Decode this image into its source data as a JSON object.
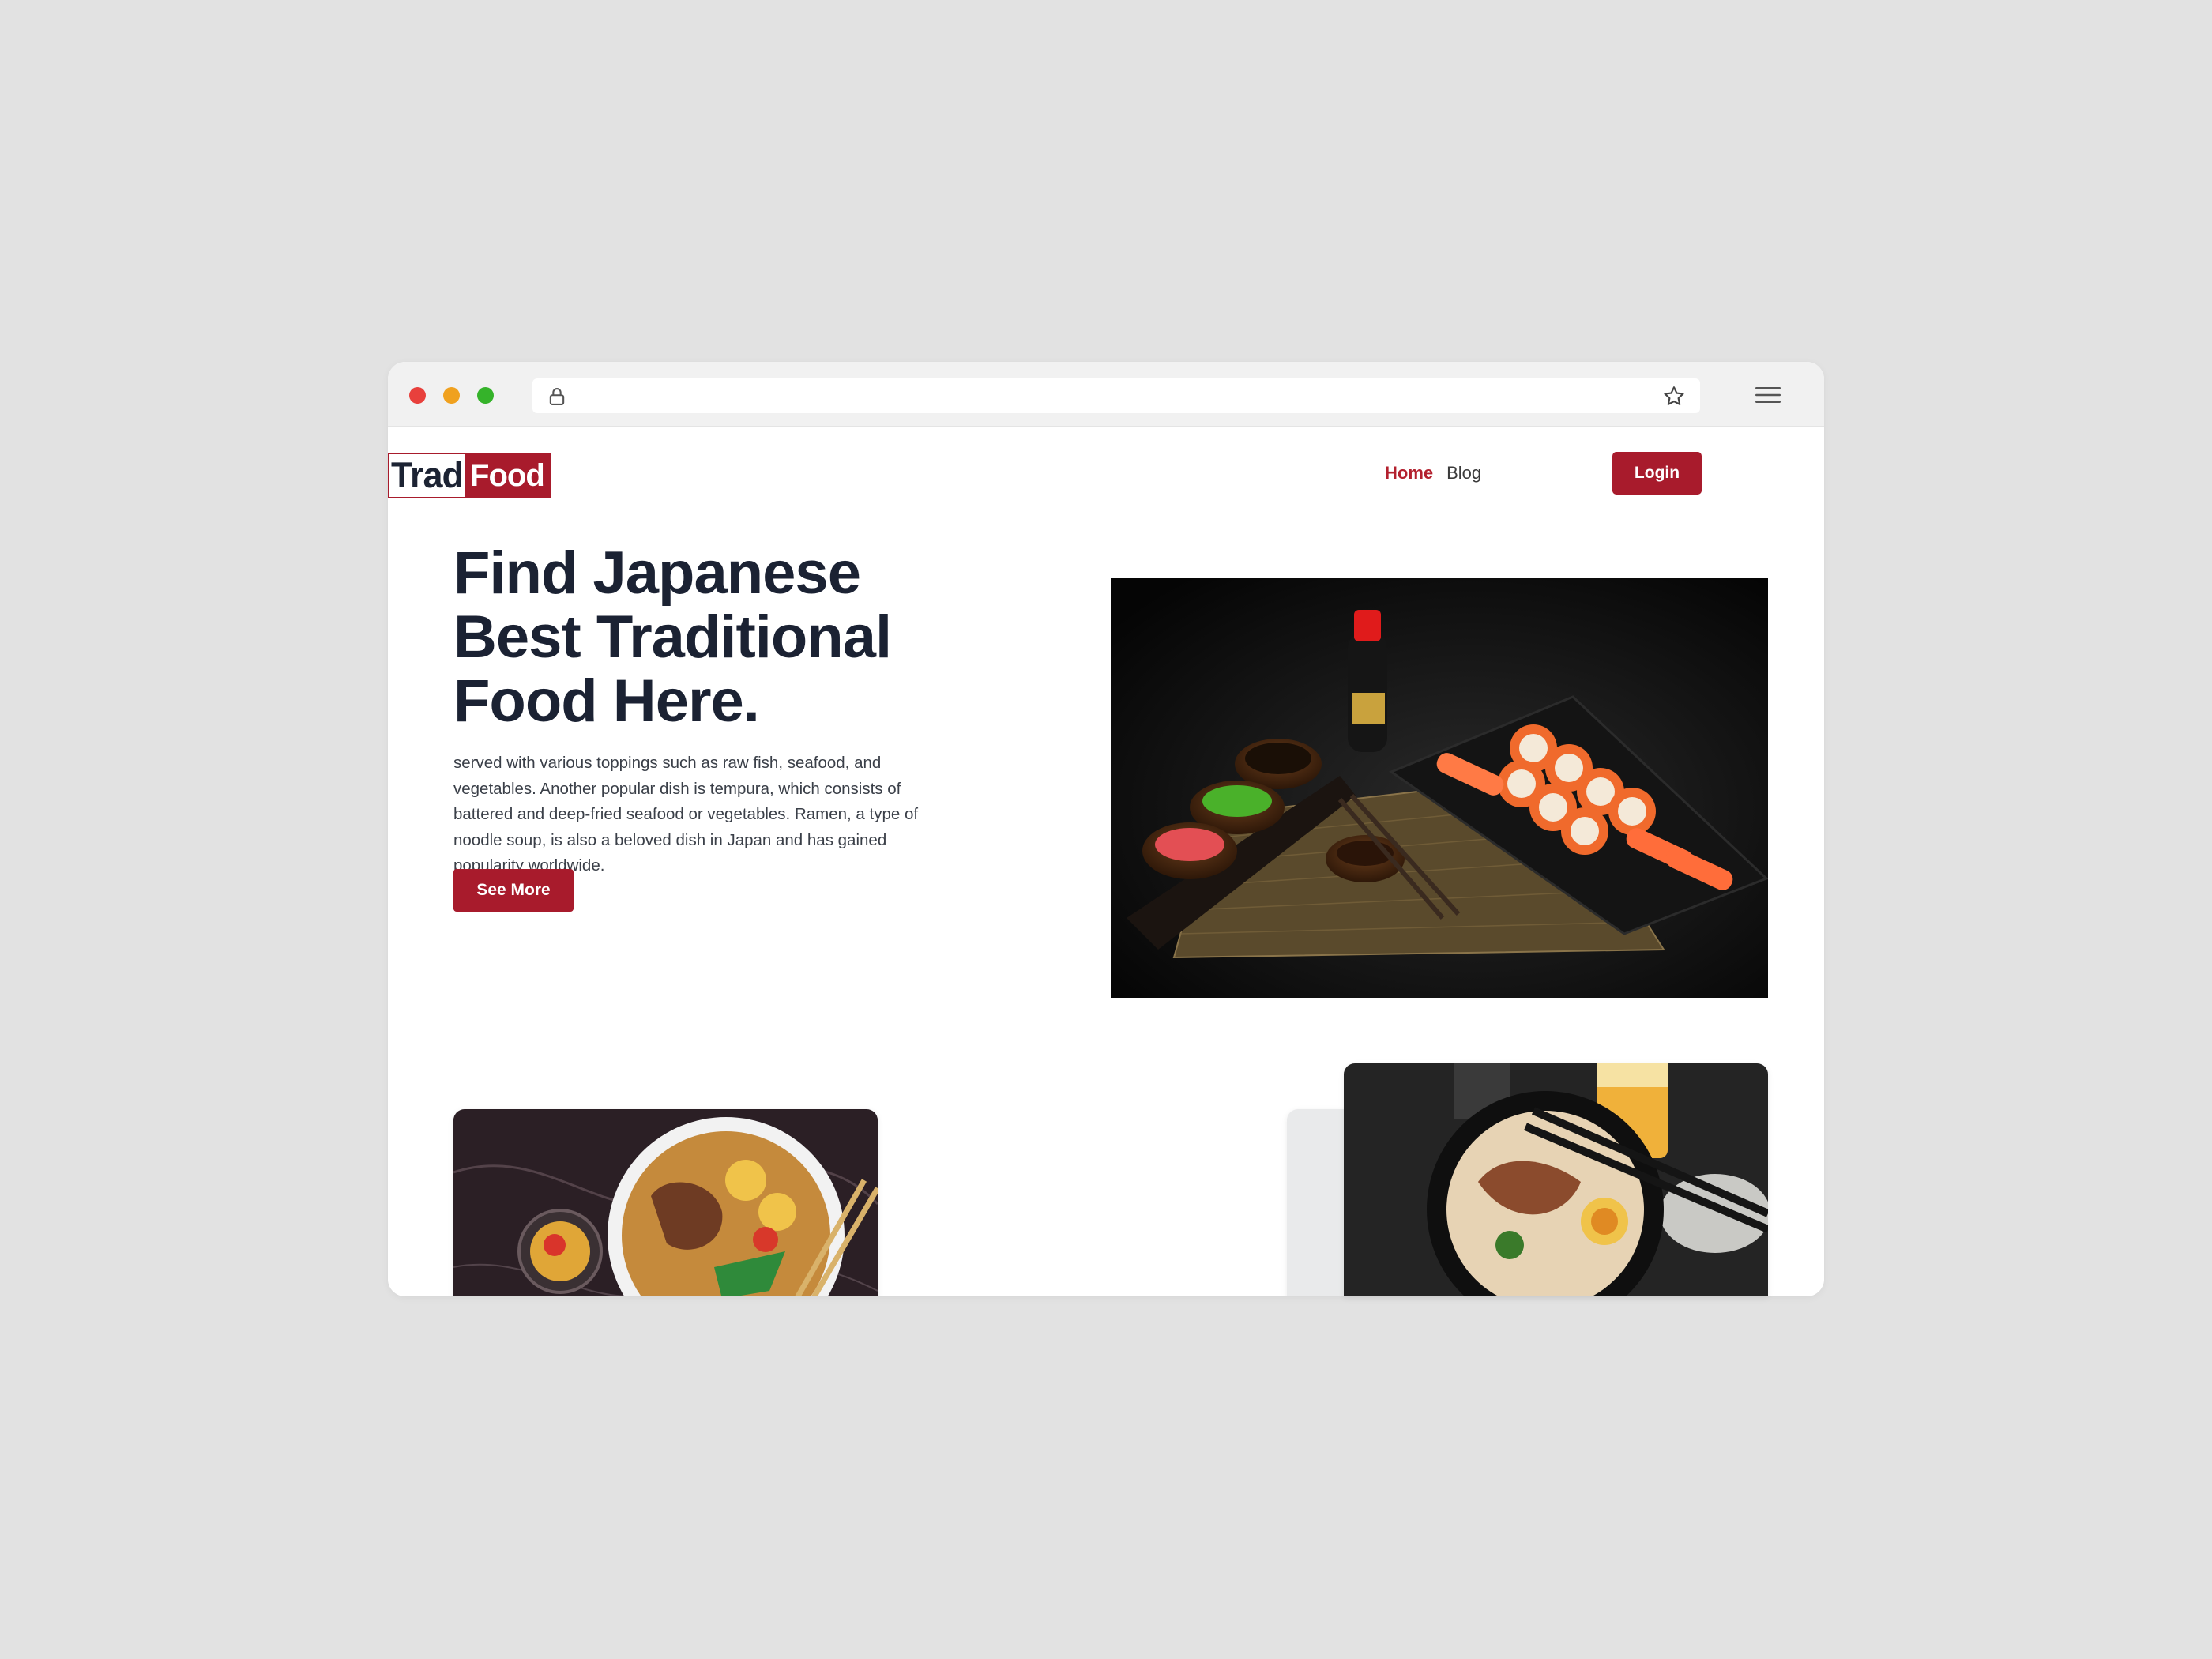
{
  "browser": {
    "url": "",
    "icons": [
      "lock-icon",
      "star-icon",
      "menu-icon"
    ]
  },
  "logo": {
    "part1": "Trad",
    "part2": "Food"
  },
  "nav": {
    "home": "Home",
    "blog": "Blog"
  },
  "login_label": "Login",
  "hero": {
    "title": "Find Japanese Best Traditional Food Here.",
    "text": "served with various toppings such as raw fish, seafood, and vegetables. Another popular dish is tempura, which consists of battered and deep-fried seafood or vegetables. Ramen, a type of noodle soup, is also a beloved dish in Japan and has gained popularity worldwide.",
    "button": "See More",
    "image": "sushi-platter-with-soy-sauce"
  },
  "cards": [
    {
      "image": "ramen-bowl-on-marble"
    },
    {
      "image": "noodle-bowl-with-egg"
    },
    {
      "image": "ramen-in-black-bowl-with-beer"
    }
  ],
  "colors": {
    "accent": "#a81b2c",
    "heading": "#1b2233",
    "background": "#e2e2e2"
  }
}
